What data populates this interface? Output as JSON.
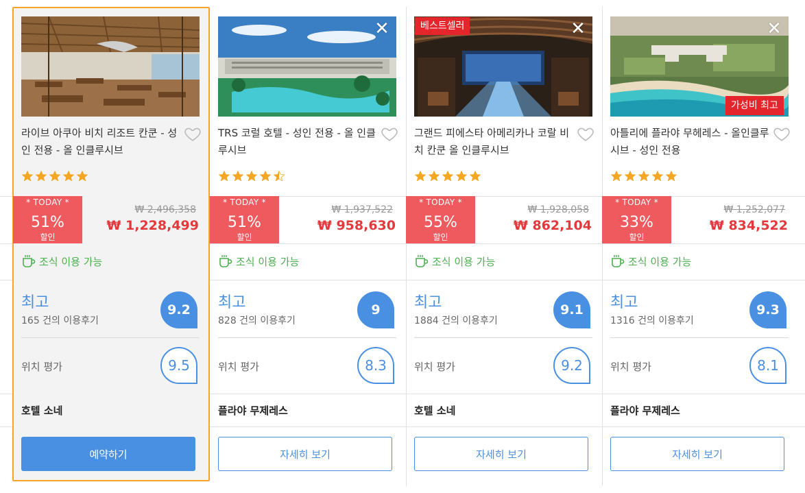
{
  "hotels": [
    {
      "name": "라이브 아쿠아 비치 리조트 칸쿤 - 성인 전용 - 올 인클루시브",
      "stars": 5,
      "deal_tag": "* TODAY *",
      "discount": "51%",
      "discount_label": "할인",
      "price_original": "₩ 2,496,358",
      "price_sale": "₩ 1,228,499",
      "breakfast": "조식 이용 가능",
      "rating_word": "최고",
      "reviews": "165 건의 이용후기",
      "score": "9.2",
      "location_label": "위치 평가",
      "location_score": "9.5",
      "area": "호텔 소네",
      "button": "예약하기",
      "badge_top": "",
      "badge_bottom": "",
      "selected": true
    },
    {
      "name": "TRS 코럴 호텔 - 성인 전용 - 올 인클루시브",
      "stars": 4.5,
      "deal_tag": "* TODAY *",
      "discount": "51%",
      "discount_label": "할인",
      "price_original": "₩ 1,937,522",
      "price_sale": "₩ 958,630",
      "breakfast": "조식 이용 가능",
      "rating_word": "최고",
      "reviews": "828 건의 이용후기",
      "score": "9",
      "location_label": "위치 평가",
      "location_score": "8.3",
      "area": "플라야 무제레스",
      "button": "자세히 보기",
      "badge_top": "",
      "badge_bottom": "",
      "selected": false
    },
    {
      "name": "그랜드 피에스타 아메리카나 코랄 비치 칸쿤 올 인클루시브",
      "stars": 5,
      "deal_tag": "* TODAY *",
      "discount": "55%",
      "discount_label": "할인",
      "price_original": "₩ 1,928,058",
      "price_sale": "₩ 862,104",
      "breakfast": "조식 이용 가능",
      "rating_word": "최고",
      "reviews": "1884 건의 이용후기",
      "score": "9.1",
      "location_label": "위치 평가",
      "location_score": "9.2",
      "area": "호텔 소네",
      "button": "자세히 보기",
      "badge_top": "베스트셀러",
      "badge_bottom": "",
      "selected": false
    },
    {
      "name": "아틀리에 플라야 무헤레스 - 올인클루시브 - 성인 전용",
      "stars": 5,
      "deal_tag": "* TODAY *",
      "discount": "33%",
      "discount_label": "할인",
      "price_original": "₩ 1,252,077",
      "price_sale": "₩ 834,522",
      "breakfast": "조식 이용 가능",
      "rating_word": "최고",
      "reviews": "1316 건의 이용후기",
      "score": "9.3",
      "location_label": "위치 평가",
      "location_score": "8.1",
      "area": "플라야 무제레스",
      "button": "자세히 보기",
      "badge_top": "",
      "badge_bottom": "가성비 최고",
      "selected": false
    }
  ],
  "close_symbol": "✕",
  "colors": {
    "accent": "#4a90e2",
    "deal": "#ef5a5f",
    "sale_price": "#e4393c",
    "breakfast": "#4caf50",
    "star": "#f5a623",
    "selected_border": "#f5a623",
    "badge": "#e4262c"
  }
}
